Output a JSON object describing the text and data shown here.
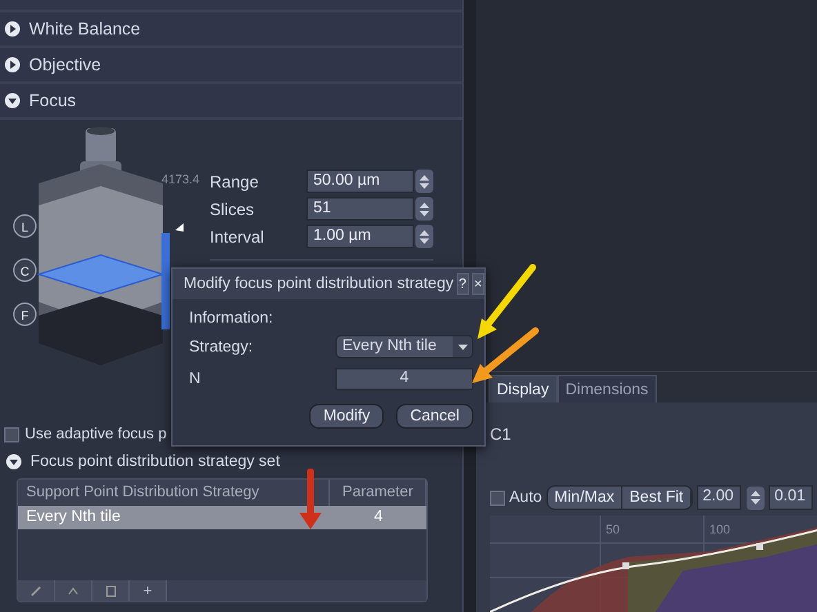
{
  "sections": [
    {
      "label": "White Balance",
      "expanded": false
    },
    {
      "label": "Objective",
      "expanded": false
    },
    {
      "label": "Focus",
      "expanded": true
    }
  ],
  "focus": {
    "scale_value": "4173.4",
    "position_buttons": [
      "L",
      "C",
      "F"
    ],
    "fields": [
      {
        "label": "Range",
        "value": "50.00 µm"
      },
      {
        "label": "Slices",
        "value": "51"
      },
      {
        "label": "Interval",
        "value": "1.00 µm"
      }
    ]
  },
  "adaptive_checkbox": {
    "label": "Use adaptive focus p",
    "checked": false
  },
  "strategy_set": {
    "label": "Focus point distribution strategy set",
    "expanded": true,
    "columns": [
      "Support Point Distribution Strategy",
      "Parameter"
    ],
    "rows": [
      {
        "cells": [
          "Every Nth tile",
          "4"
        ],
        "selected": true
      }
    ],
    "add_button": "+"
  },
  "dialog": {
    "title": "Modify focus point distribution strategy",
    "help": "?",
    "close": "×",
    "information_label": "Information:",
    "strategy_label": "Strategy:",
    "strategy_value": "Every Nth tile",
    "n_label": "N",
    "n_value": "4",
    "buttons": [
      "Modify",
      "Cancel"
    ]
  },
  "display": {
    "tabs": [
      {
        "label": "Display",
        "selected": true
      },
      {
        "label": "Dimensions",
        "selected": false
      }
    ],
    "channel": "C1",
    "auto": {
      "label": "Auto",
      "checked": false
    },
    "buttons": [
      "Min/Max",
      "Best Fit"
    ],
    "gamma": "2.00",
    "value_field": "0.01",
    "histogram": {
      "tick_labels": [
        "50",
        "100"
      ]
    }
  },
  "annotations": [
    {
      "color": "#f5d800"
    },
    {
      "color": "#f39a1e"
    },
    {
      "color": "#d0301a"
    }
  ]
}
